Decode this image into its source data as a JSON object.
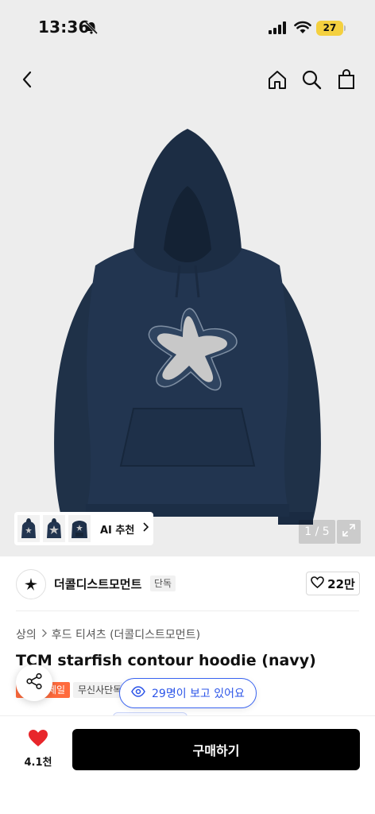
{
  "status_bar": {
    "time": "13:36",
    "battery": "27"
  },
  "icons": {
    "back": "chevron-left-icon",
    "home": "home-icon",
    "search": "search-icon",
    "cart": "shopping-bag-icon",
    "share": "share-icon",
    "heart": "heart-icon",
    "eye": "eye-icon",
    "expand": "expand-icon"
  },
  "gallery": {
    "ai_label": "AI 추천",
    "pager": "1 / 5",
    "thumbnail_count": 3
  },
  "brand": {
    "name": "더콜디스트모먼트",
    "badge": "단독",
    "like_count": "22만"
  },
  "product": {
    "breadcrumb": [
      "상의",
      "후드 티셔츠 (더콜디스트모먼트)"
    ],
    "title": "TCM starfish contour hoodie (navy)",
    "badges": {
      "sale": "세일",
      "exclusive": "무신사단독"
    },
    "viewers": "29명이 보고 있어요"
  },
  "bottom_bar": {
    "heart_count": "4.1천",
    "buy_label": "구매하기"
  },
  "colors": {
    "hoodie": "#1f3148",
    "starfish": "#c8c8c8",
    "sale_badge": "#ff6b3d",
    "viewer_accent": "#2c55e8",
    "heart": "#e8262b",
    "buy_button": "#000000",
    "battery": "#f4d03f"
  }
}
